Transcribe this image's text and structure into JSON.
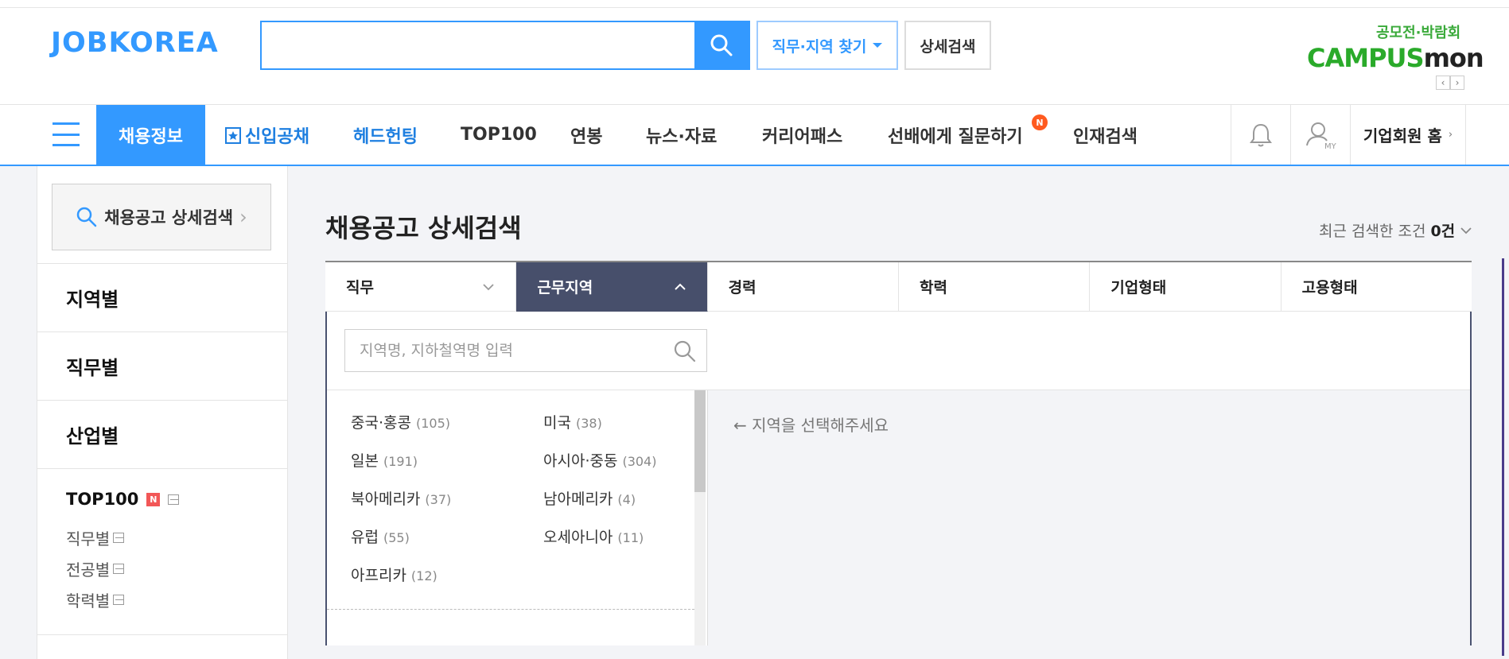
{
  "header": {
    "logo": "JOBKOREA",
    "search_placeholder": "",
    "find_button": "직무·지역 찾기",
    "detail_button": "상세검색",
    "promo": {
      "subtitle": "공모전·박람회",
      "logo_left": "CAMPUS",
      "logo_right": "mon",
      "arrow_prev": "‹",
      "arrow_next": "›"
    }
  },
  "nav": {
    "items": [
      "채용정보",
      "신입공채",
      "헤드헌팅",
      "TOP100",
      "연봉",
      "뉴스·자료",
      "커리어패스",
      "선배에게 질문하기",
      "인재검색"
    ],
    "new_badge": "N",
    "my_label": "MY",
    "corporate_home": "기업회원 홈"
  },
  "sidebar": {
    "search_label": "채용공고 상세검색",
    "categories": [
      "지역별",
      "직무별",
      "산업별"
    ],
    "top100": {
      "title": "TOP100",
      "badge": "N",
      "links": [
        "직무별",
        "전공별",
        "학력별"
      ]
    }
  },
  "main": {
    "title": "채용공고 상세검색",
    "recent_label": "최근 검색한 조건",
    "recent_count": "0건",
    "tabs": [
      "직무",
      "근무지역",
      "경력",
      "학력",
      "기업형태",
      "고용형태"
    ],
    "active_tab": "근무지역",
    "region_search_placeholder": "지역명, 지하철역명 입력",
    "hint": "← 지역을 선택해주세요",
    "regions": [
      {
        "name": "중국·홍콩",
        "count": "(105)"
      },
      {
        "name": "미국",
        "count": "(38)"
      },
      {
        "name": "일본",
        "count": "(191)"
      },
      {
        "name": "아시아·중동",
        "count": "(304)"
      },
      {
        "name": "북아메리카",
        "count": "(37)"
      },
      {
        "name": "남아메리카",
        "count": "(4)"
      },
      {
        "name": "유럽",
        "count": "(55)"
      },
      {
        "name": "오세아니아",
        "count": "(11)"
      },
      {
        "name": "아프리카",
        "count": "(12)"
      }
    ]
  },
  "colors": {
    "brand_blue": "#3399ff",
    "active_tab": "#474f6b",
    "new_badge": "#ff5a1f",
    "campus_green": "#2aaa2a"
  }
}
